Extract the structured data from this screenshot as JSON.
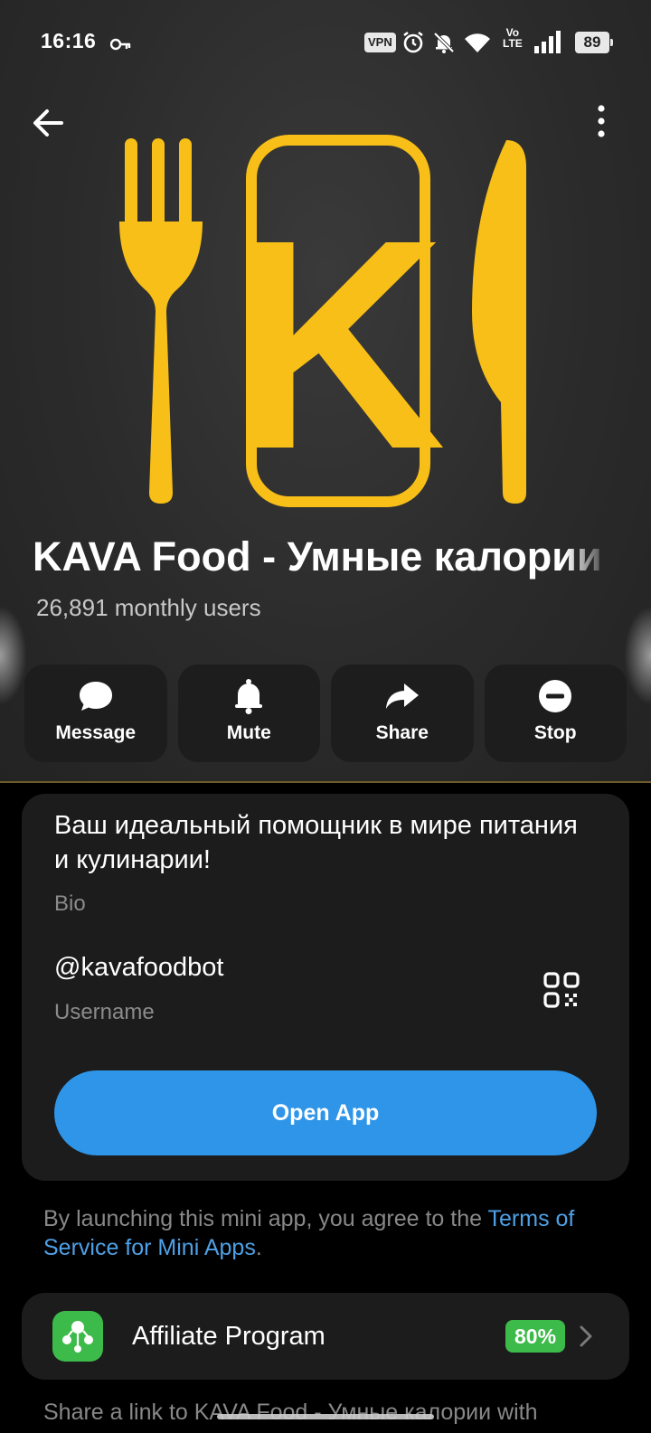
{
  "status_bar": {
    "time": "16:16",
    "vpn": "VPN",
    "lte_top": "Vo",
    "lte_bottom": "LTE",
    "battery": "89"
  },
  "bot": {
    "title": "KAVA Food - Умные калории",
    "monthly_users": "26,891 monthly users",
    "logo_letter": "K",
    "logo_color": "#f7bf17"
  },
  "actions": [
    {
      "label": "Message",
      "icon": "message-icon"
    },
    {
      "label": "Mute",
      "icon": "bell-icon"
    },
    {
      "label": "Share",
      "icon": "share-icon"
    },
    {
      "label": "Stop",
      "icon": "stop-icon"
    }
  ],
  "info": {
    "bio": "Ваш идеальный помощник в мире питания и кулинарии!",
    "bio_label": "Bio",
    "username": "@kavafoodbot",
    "username_label": "Username",
    "open_app": "Open App"
  },
  "terms": {
    "prefix": "By launching this mini app, you agree to the ",
    "link": "Terms of Service for Mini Apps",
    "suffix": "."
  },
  "affiliate": {
    "label": "Affiliate Program",
    "badge": "80%"
  },
  "footer": {
    "text": "Share a link to KAVA Food - Умные калории with"
  },
  "colors": {
    "accent_blue": "#2e95e8",
    "link_blue": "#4ea0e6",
    "green": "#3dbb4a",
    "logo_yellow": "#f7bf17"
  }
}
